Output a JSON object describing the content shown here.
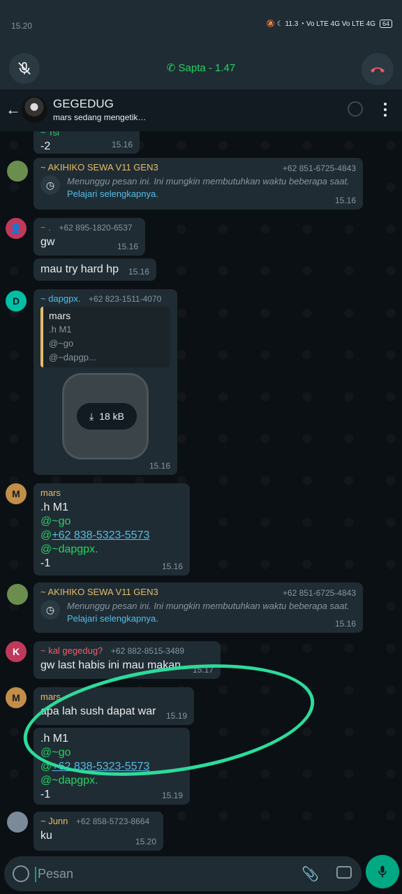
{
  "status_bar": {
    "time": "15.20",
    "icons": "🔕 ☾ 11.3 ◔ Vo LTE 4G Vo LTE 4G",
    "battery": "64"
  },
  "call_bar": {
    "label": "Sapta - 1.47"
  },
  "header": {
    "title": "GEGEDUG",
    "subtitle": "mars sedang mengetik…"
  },
  "messages": [
    {
      "id": "m0",
      "text_top": "~ Tsi",
      "text": "-2",
      "time": "15.16"
    },
    {
      "id": "m1",
      "sender": "~ AKIHIKO SEWA V11 GEN3",
      "sender_color": "#e5bc6a",
      "phone": "+62 851-6725-4843",
      "waiting": "Menunggu pesan ini. Ini mungkin membutuhkan waktu beberapa saat.",
      "learn_more": "Pelajari selengkapnya.",
      "time": "15.16"
    },
    {
      "id": "m2",
      "sender": "~ .",
      "sender_color": "#f15c6d",
      "phone": "+62 895-1820-6537",
      "text": "gw",
      "time": "15.16"
    },
    {
      "id": "m3",
      "text": "mau try hard hp",
      "time": "15.16"
    },
    {
      "id": "m4",
      "sender": "~ dapgpx.",
      "sender_color": "#53bdeb",
      "phone": "+62 823-1511-4070",
      "quote_author": "mars",
      "quote_lines": [
        ".h M1",
        "@~go",
        "@~dapgp..."
      ],
      "file_size": "18 kB",
      "time": "15.16",
      "avatar": "D"
    },
    {
      "id": "m5",
      "sender": "mars",
      "sender_color": "#e5bc6a",
      "avatar": "M",
      "line1": ".h M1",
      "line2": "@~go",
      "line3_prefix": "@",
      "line3_link": "+62 838-5323-5573",
      "line4": "@~dapgpx.",
      "line5": "-1",
      "time": "15.16"
    },
    {
      "id": "m6",
      "sender": "~ AKIHIKO SEWA V11 GEN3",
      "sender_color": "#e5bc6a",
      "phone": "+62 851-6725-4843",
      "waiting": "Menunggu pesan ini. Ini mungkin membutuhkan waktu beberapa saat.",
      "learn_more": "Pelajari selengkapnya.",
      "time": "15.16"
    },
    {
      "id": "m7",
      "sender": "~ kal gegedug?",
      "sender_color": "#f15c6d",
      "phone": "+62 882-8515-3489",
      "text": "gw last habis ini mau makan",
      "time": "15.17",
      "avatar": "K"
    },
    {
      "id": "m8",
      "sender": "mars",
      "sender_color": "#e5bc6a",
      "text": "apa lah sush dapat war",
      "time": "15.19",
      "avatar": "M"
    },
    {
      "id": "m9",
      "line1": ".h M1",
      "line2": "@~go",
      "line3_prefix": "@",
      "line3_link": "+62 838-5323-5573",
      "line4": "@~dapgpx.",
      "line5": "-1",
      "time": "15.19"
    },
    {
      "id": "m10",
      "sender": "~ Junn",
      "sender_color": "#e5bc6a",
      "phone": "+62 858-5723-8664",
      "text": "ku",
      "time": "15.20"
    }
  ],
  "input": {
    "placeholder": "Pesan"
  }
}
